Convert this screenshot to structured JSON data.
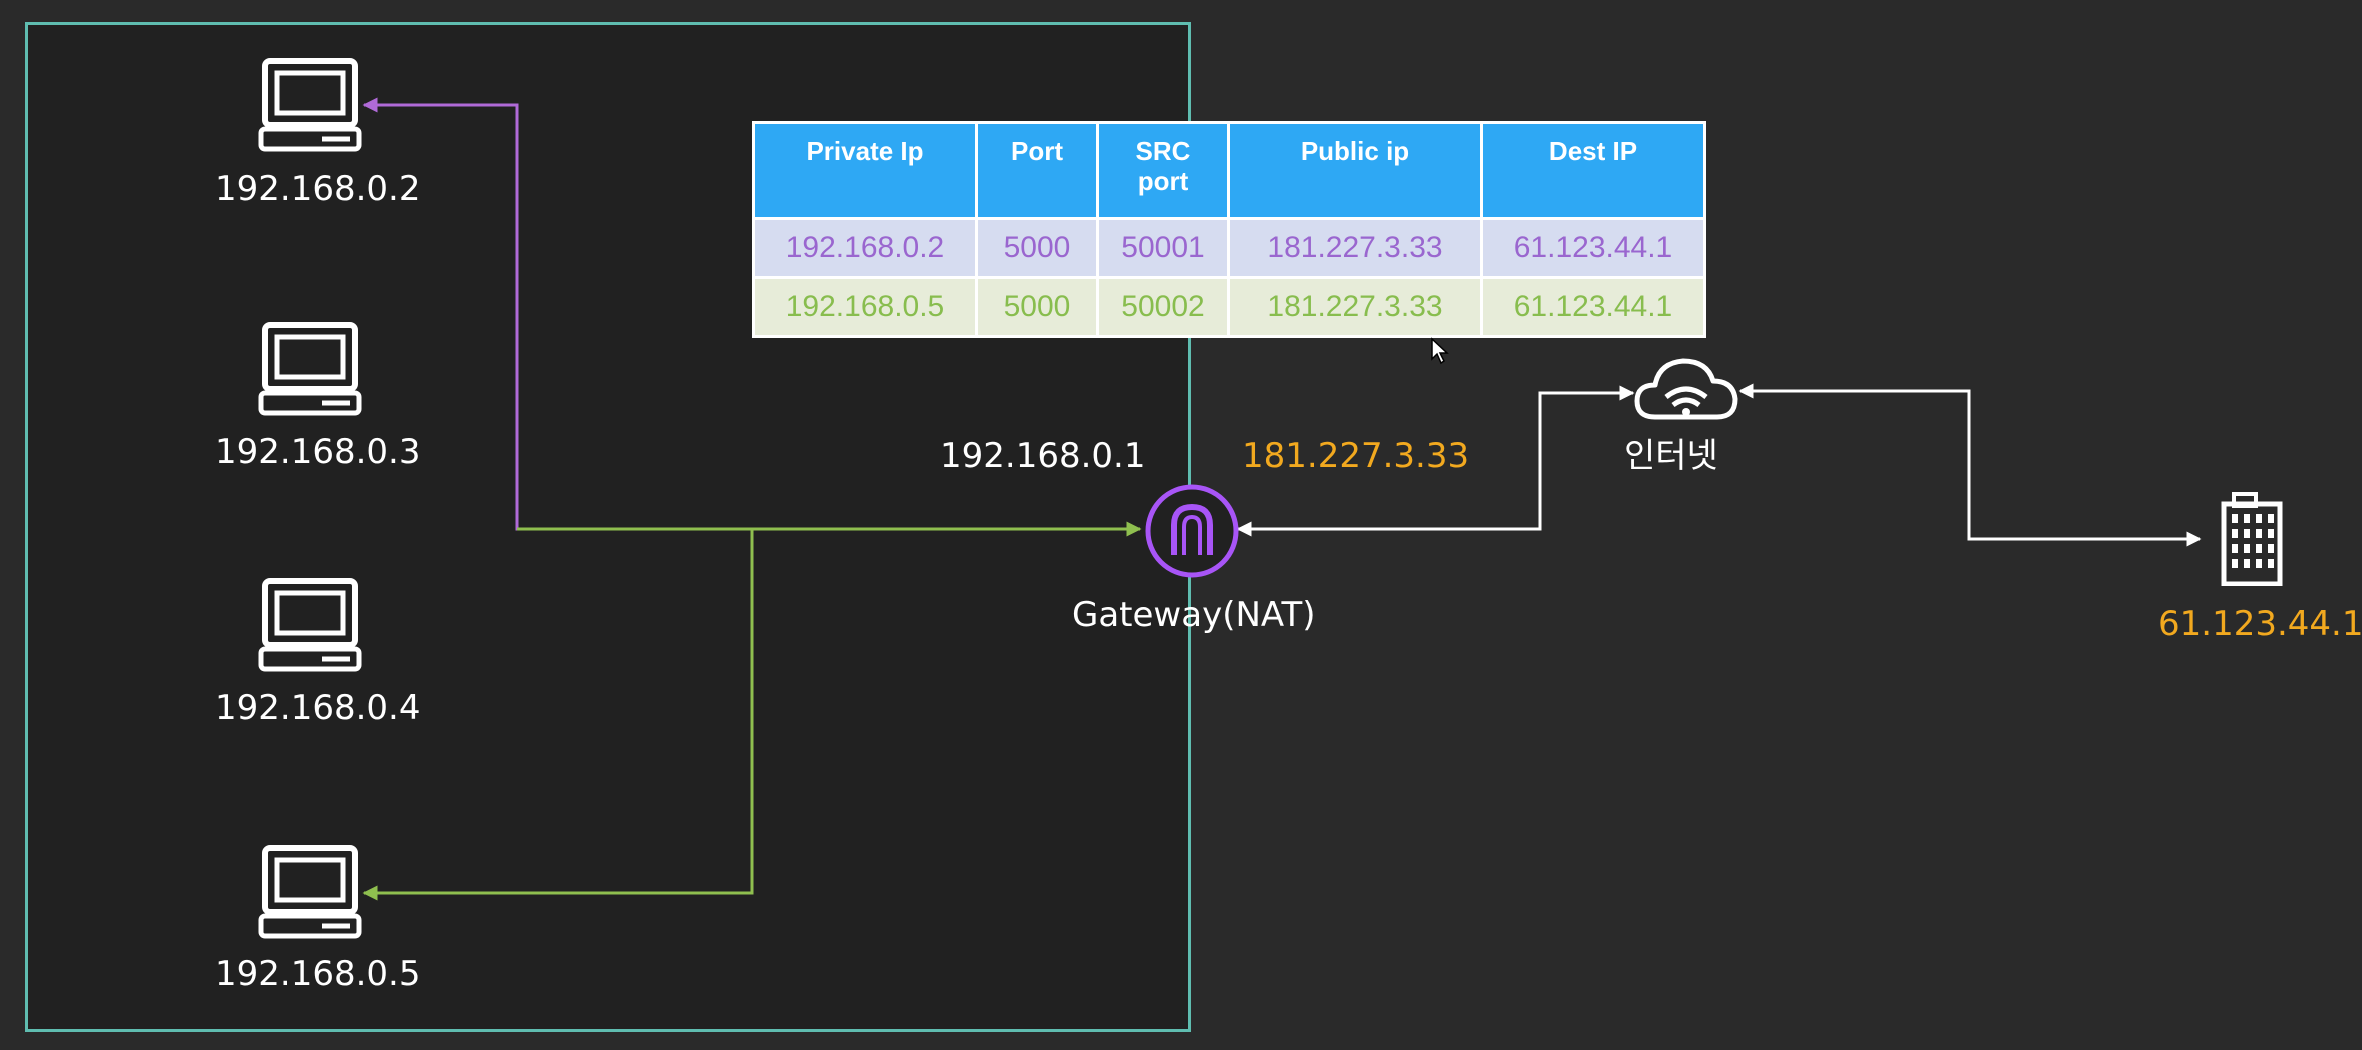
{
  "network": {
    "hosts": [
      {
        "ip": "192.168.0.2"
      },
      {
        "ip": "192.168.0.3"
      },
      {
        "ip": "192.168.0.4"
      },
      {
        "ip": "192.168.0.5"
      }
    ],
    "gateway": {
      "name": "Gateway(NAT)",
      "private_ip": "192.168.0.1",
      "public_ip": "181.227.3.33"
    },
    "internet_label": "인터넷",
    "server_ip": "61.123.44.1"
  },
  "nat_table": {
    "headers": [
      "Private Ip",
      "Port",
      "SRC\nport",
      "Public ip",
      "Dest IP"
    ],
    "rows": [
      [
        "192.168.0.2",
        "5000",
        "50001",
        "181.227.3.33",
        "61.123.44.1"
      ],
      [
        "192.168.0.5",
        "5000",
        "50002",
        "181.227.3.33",
        "61.123.44.1"
      ]
    ]
  },
  "colors": {
    "background": "#2a2a2a",
    "lan_box_fill": "#212121",
    "lan_box_border": "#5fbdb0",
    "purple_path": "#b06ad8",
    "green_path": "#8fbf4f",
    "gateway_icon": "#a855f7",
    "highlight_ip": "#f2a91f",
    "table_header": "#2ea8f4",
    "row_purple_text": "#9a66cf",
    "row_green_text": "#88bd4e"
  },
  "icons": {
    "host": "desktop-computer-icon",
    "gateway": "nat-gateway-icon",
    "internet": "cloud-wifi-icon",
    "server": "office-building-icon",
    "cursor": "mouse-pointer-icon"
  }
}
